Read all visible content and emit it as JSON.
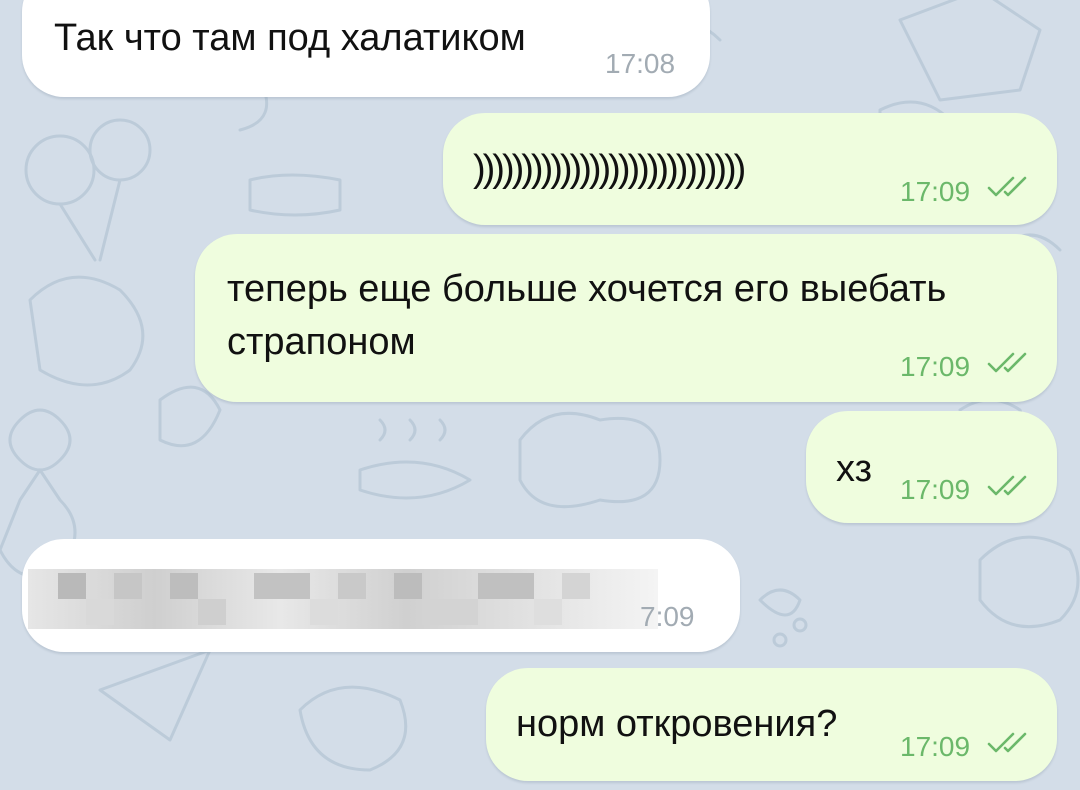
{
  "colors": {
    "background": "#d3dde8",
    "incoming_bubble": "#ffffff",
    "outgoing_bubble": "#effdde",
    "outgoing_time": "#6bb86a",
    "incoming_time": "#a2abb3"
  },
  "messages": [
    {
      "direction": "incoming",
      "text": "Так что там под халатиком",
      "time": "17:08"
    },
    {
      "direction": "outgoing",
      "text": "))))))))))))))))))))))))))))",
      "time": "17:09",
      "status_icon": "double-check-icon"
    },
    {
      "direction": "outgoing",
      "text_line1": "теперь еще больше хочется его выебать",
      "text_line2": "страпоном",
      "time": "17:09",
      "status_icon": "double-check-icon"
    },
    {
      "direction": "outgoing",
      "text": "хз",
      "time": "17:09",
      "status_icon": "double-check-icon"
    },
    {
      "direction": "incoming",
      "text_redacted": true,
      "time_visible": "7:09"
    },
    {
      "direction": "outgoing",
      "text": "норм откровения?",
      "time": "17:09",
      "status_icon": "double-check-icon"
    }
  ]
}
